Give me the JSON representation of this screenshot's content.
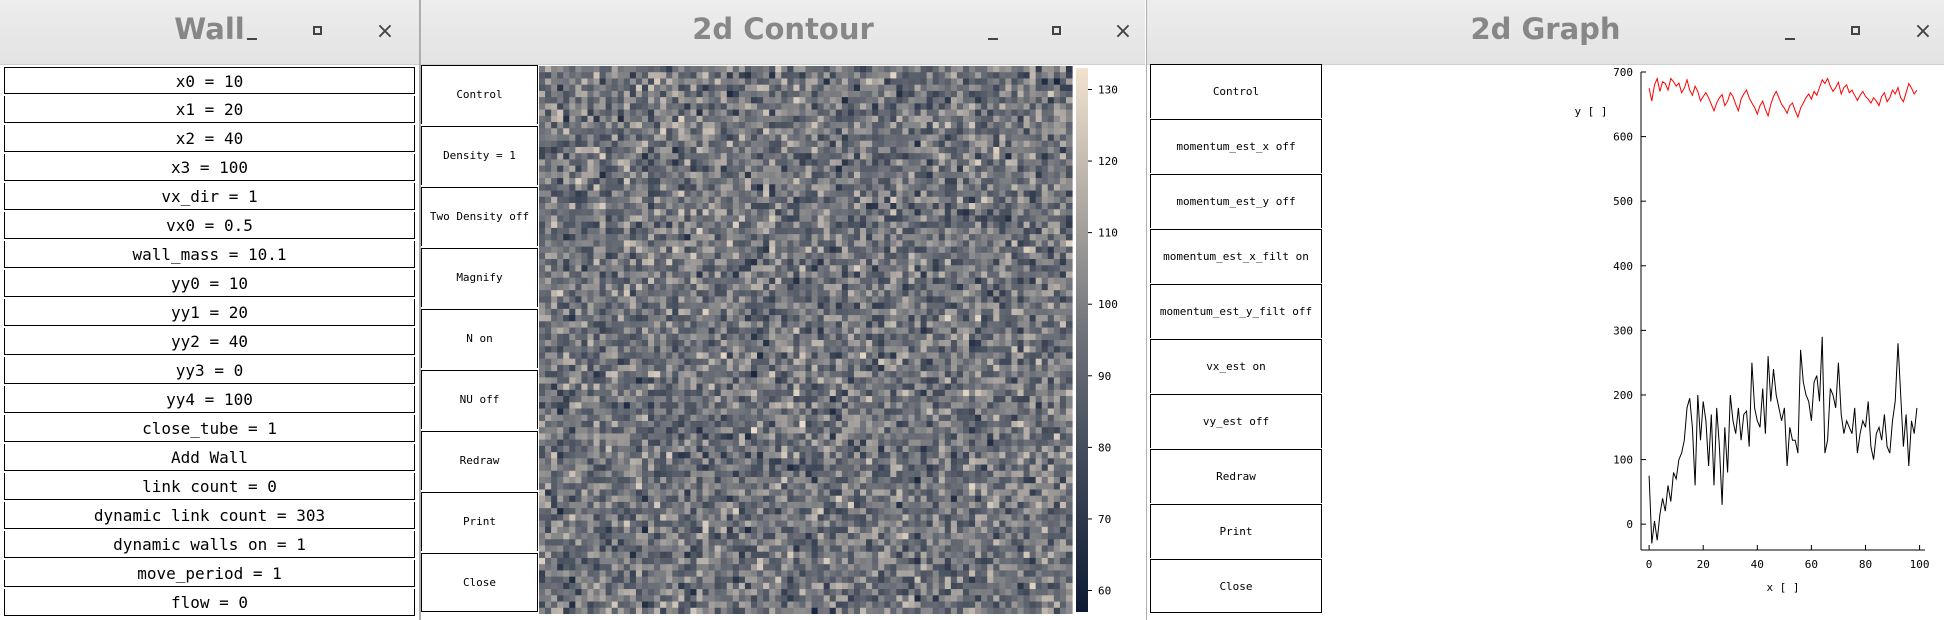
{
  "wall_window": {
    "title": "Wall",
    "controls": {
      "minimize": "_",
      "maximize": "□",
      "close": "×"
    },
    "rows": [
      "x0 = 10",
      "x1 = 20",
      "x2 = 40",
      "x3 = 100",
      "vx_dir = 1",
      "vx0 = 0.5",
      "wall_mass = 10.1",
      "yy0 = 10",
      "yy1 = 20",
      "yy2 = 40",
      "yy3 = 0",
      "yy4 = 100",
      "close_tube = 1",
      "Add Wall",
      "link count = 0",
      "dynamic link count = 303",
      "dynamic walls on = 1",
      "move_period = 1",
      "flow = 0"
    ]
  },
  "contour_window": {
    "title": "2d Contour",
    "buttons": [
      "Control",
      "Density = 1",
      "Two Density  off",
      "Magnify",
      "N on",
      "NU off",
      "Redraw",
      "Print",
      "Close"
    ],
    "colorbar": {
      "min": 57,
      "max": 133,
      "ticks": [
        "130",
        "120",
        "110",
        "100",
        "90",
        "80",
        "70",
        "60"
      ],
      "low_color": "#0c1a33",
      "high_color": "#f2e3cf"
    },
    "grid": {
      "cols": 88,
      "rows": 88,
      "noise_range": [
        60,
        132
      ]
    }
  },
  "graph_window": {
    "title": "2d Graph",
    "buttons": [
      "Control",
      "momentum_est_x off",
      "momentum_est_y off",
      "momentum_est_x_filt on",
      "momentum_est_y_filt off",
      "vx_est on",
      "vy_est off",
      "Redraw",
      "Print",
      "Close"
    ],
    "chart_data": {
      "type": "line",
      "title": "",
      "xlabel": "x [ ]",
      "ylabel": "y [ ]",
      "xlim": [
        -3,
        102
      ],
      "ylim": [
        -40,
        700
      ],
      "xticks": [
        "0",
        "20",
        "40",
        "60",
        "80",
        "100"
      ],
      "yticks": [
        "700",
        "600",
        "500",
        "400",
        "300",
        "200",
        "100",
        "0"
      ],
      "grid": false,
      "series": [
        {
          "color": "#ff0000",
          "x": [
            0,
            1,
            2,
            3,
            4,
            5,
            6,
            7,
            8,
            9,
            10,
            11,
            12,
            13,
            14,
            15,
            16,
            17,
            18,
            19,
            20,
            21,
            22,
            23,
            24,
            25,
            26,
            27,
            28,
            29,
            30,
            31,
            32,
            33,
            34,
            35,
            36,
            37,
            38,
            39,
            40,
            41,
            42,
            43,
            44,
            45,
            46,
            47,
            48,
            49,
            50,
            51,
            52,
            53,
            54,
            55,
            56,
            57,
            58,
            59,
            60,
            61,
            62,
            63,
            64,
            65,
            66,
            67,
            68,
            69,
            70,
            71,
            72,
            73,
            74,
            75,
            76,
            77,
            78,
            79,
            80,
            81,
            82,
            83,
            84,
            85,
            86,
            87,
            88,
            89,
            90,
            91,
            92,
            93,
            94,
            95,
            96,
            97,
            98,
            99
          ],
          "values": [
            675,
            655,
            680,
            690,
            670,
            685,
            682,
            672,
            690,
            685,
            678,
            683,
            668,
            675,
            688,
            672,
            664,
            678,
            670,
            655,
            662,
            668,
            660,
            650,
            640,
            652,
            660,
            665,
            648,
            655,
            668,
            662,
            650,
            640,
            658,
            666,
            672,
            660,
            652,
            645,
            635,
            648,
            655,
            642,
            632,
            650,
            662,
            670,
            660,
            650,
            644,
            636,
            648,
            652,
            640,
            630,
            644,
            652,
            660,
            666,
            658,
            670,
            664,
            676,
            688,
            682,
            690,
            678,
            670,
            676,
            684,
            666,
            676,
            680,
            668,
            672,
            664,
            656,
            664,
            670,
            662,
            658,
            652,
            660,
            655,
            648,
            662,
            668,
            654,
            660,
            672,
            666,
            676,
            660,
            654,
            668,
            682,
            675,
            666,
            672
          ]
        },
        {
          "color": "#000000",
          "x": [
            0,
            1,
            2,
            3,
            4,
            5,
            6,
            7,
            8,
            9,
            10,
            11,
            12,
            13,
            14,
            15,
            16,
            17,
            18,
            19,
            20,
            21,
            22,
            23,
            24,
            25,
            26,
            27,
            28,
            29,
            30,
            31,
            32,
            33,
            34,
            35,
            36,
            37,
            38,
            39,
            40,
            41,
            42,
            43,
            44,
            45,
            46,
            47,
            48,
            49,
            50,
            51,
            52,
            53,
            54,
            55,
            56,
            57,
            58,
            59,
            60,
            61,
            62,
            63,
            64,
            65,
            66,
            67,
            68,
            69,
            70,
            71,
            72,
            73,
            74,
            75,
            76,
            77,
            78,
            79,
            80,
            81,
            82,
            83,
            84,
            85,
            86,
            87,
            88,
            89,
            90,
            91,
            92,
            93,
            94,
            95,
            96,
            97,
            98,
            99
          ],
          "values": [
            75,
            -30,
            5,
            -25,
            15,
            40,
            20,
            60,
            35,
            80,
            70,
            100,
            110,
            130,
            180,
            195,
            150,
            60,
            200,
            130,
            190,
            160,
            90,
            170,
            60,
            180,
            120,
            30,
            150,
            80,
            200,
            160,
            140,
            180,
            130,
            170,
            175,
            120,
            250,
            180,
            160,
            150,
            210,
            140,
            260,
            190,
            240,
            200,
            180,
            160,
            180,
            90,
            150,
            130,
            130,
            110,
            270,
            220,
            200,
            190,
            160,
            220,
            230,
            190,
            290,
            110,
            130,
            210,
            200,
            180,
            250,
            170,
            140,
            160,
            150,
            140,
            180,
            110,
            140,
            160,
            150,
            190,
            120,
            100,
            140,
            150,
            130,
            170,
            120,
            110,
            160,
            190,
            280,
            200,
            120,
            170,
            90,
            160,
            140,
            180
          ]
        }
      ]
    }
  }
}
